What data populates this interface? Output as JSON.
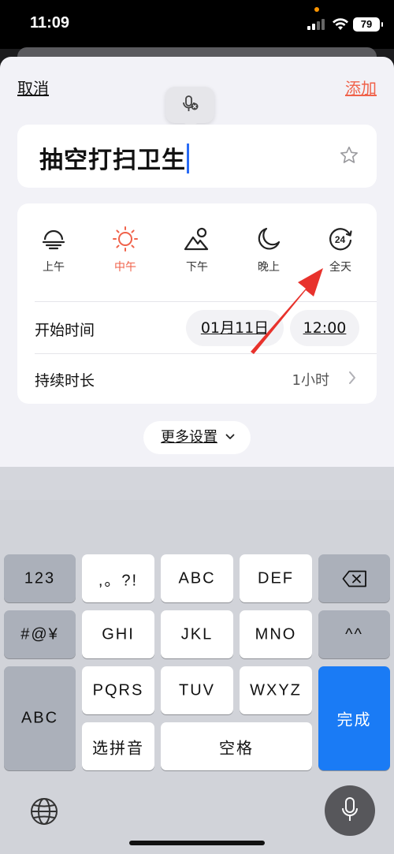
{
  "status_bar": {
    "time": "11:09",
    "battery": "79"
  },
  "nav": {
    "cancel": "取消",
    "add": "添加"
  },
  "task": {
    "title": "抽空打扫卫生"
  },
  "time_slots": [
    {
      "label": "上午",
      "icon": "sunrise-icon",
      "active": false
    },
    {
      "label": "中午",
      "icon": "sun-icon",
      "active": true
    },
    {
      "label": "下午",
      "icon": "mountain-sun-icon",
      "active": false
    },
    {
      "label": "晚上",
      "icon": "moon-icon",
      "active": false
    },
    {
      "label": "全天",
      "icon": "clock-24-icon",
      "active": false
    }
  ],
  "start": {
    "label": "开始时间",
    "date": "01月11日",
    "time": "12:00"
  },
  "duration": {
    "label": "持续时长",
    "value": "1小时"
  },
  "more_settings": "更多设置",
  "keyboard": {
    "row1": [
      "123",
      ",。?!",
      "ABC",
      "DEF"
    ],
    "row2": [
      "#@¥",
      "GHI",
      "JKL",
      "MNO",
      "^^"
    ],
    "row3": [
      "ABC",
      "PQRS",
      "TUV",
      "WXYZ"
    ],
    "row4": [
      "选拼音",
      "空格"
    ],
    "done": "完成"
  },
  "colors": {
    "accent": "#f0624a",
    "done_key": "#1a7bf5",
    "caret": "#2a6cf5"
  }
}
